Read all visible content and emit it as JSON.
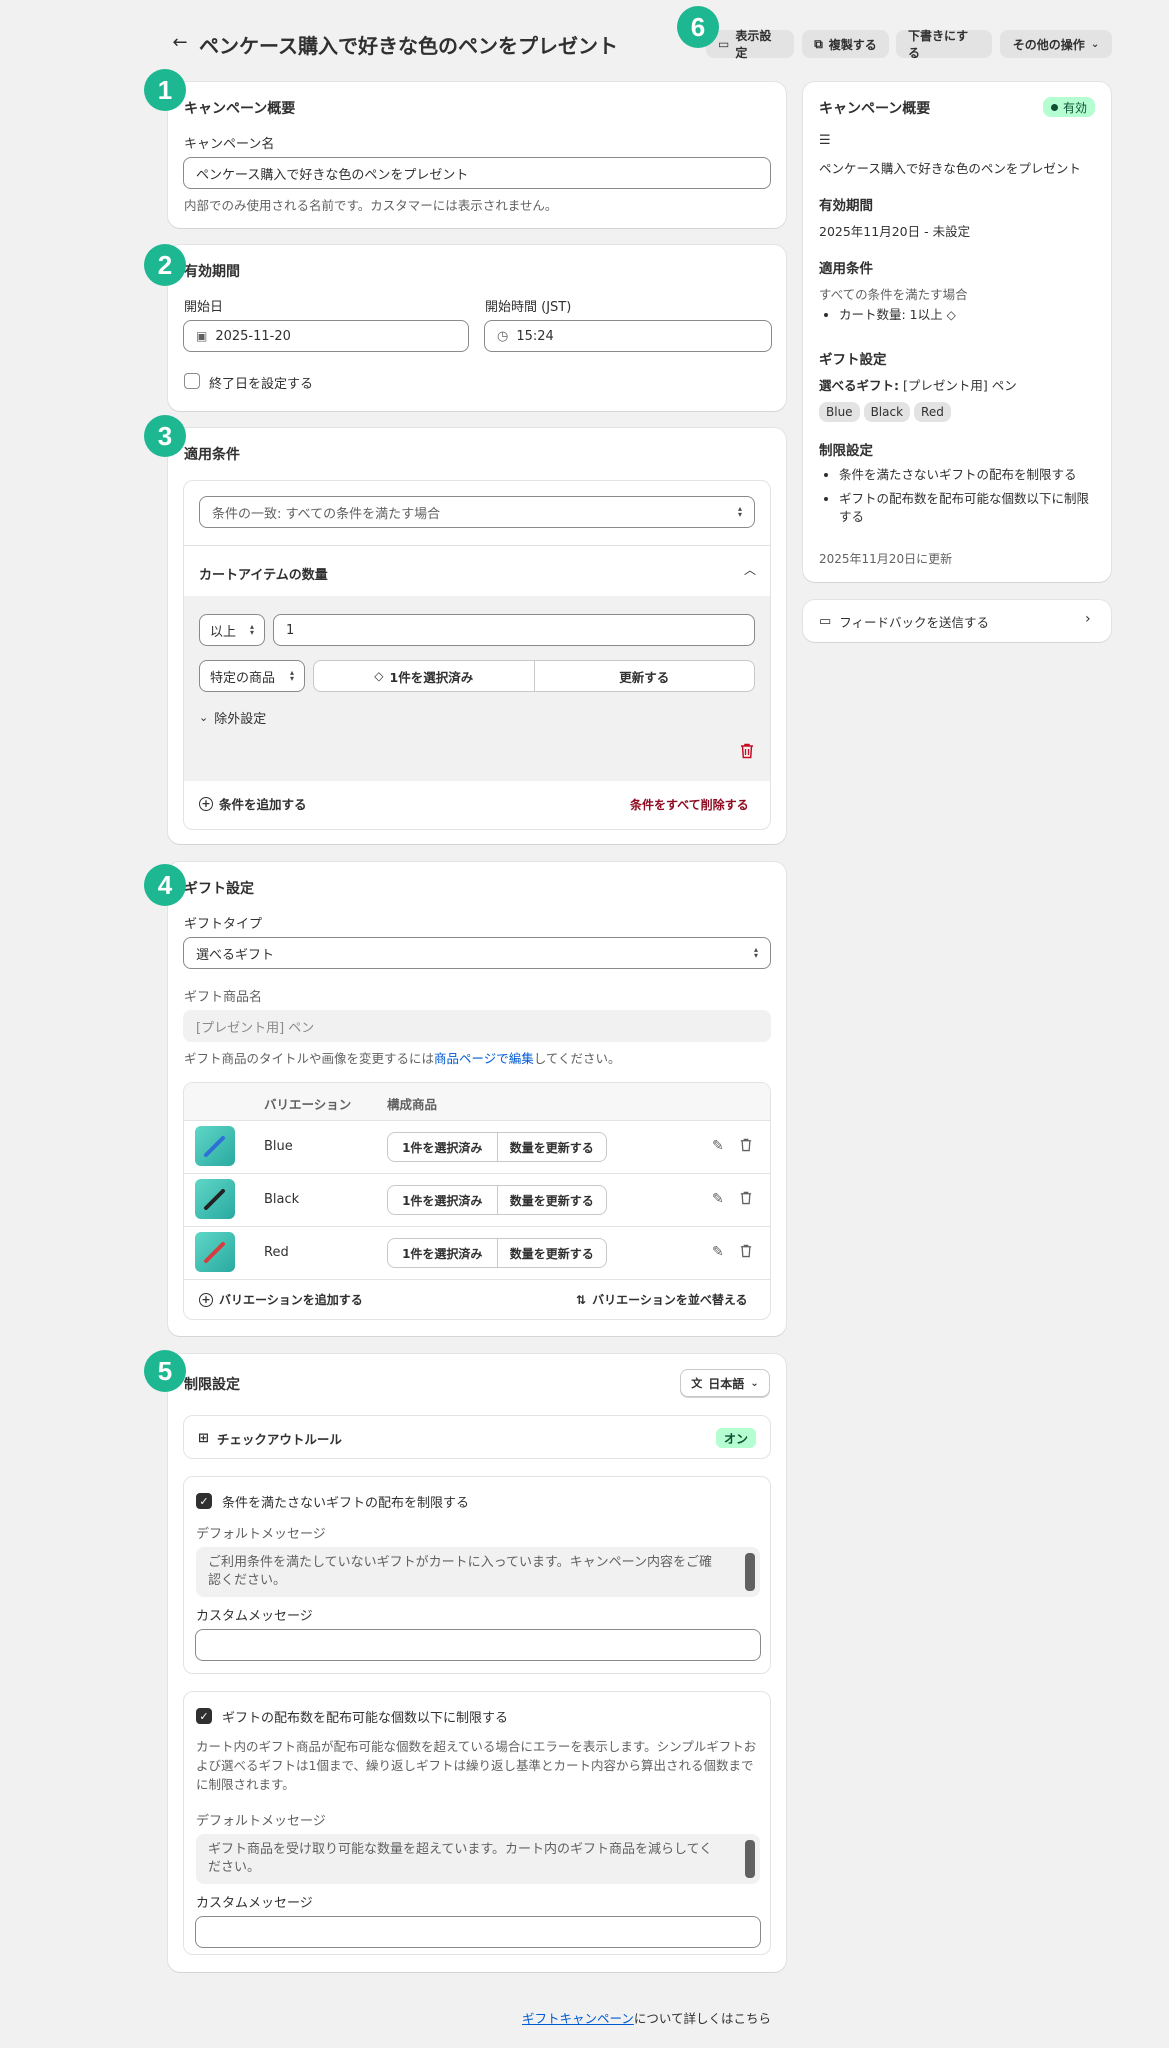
{
  "header": {
    "title": "ペンケース購入で好きな色のペンをプレゼント",
    "actions": {
      "display": "表示設定",
      "duplicate": "複製する",
      "draft": "下書きにする",
      "more": "その他の操作"
    }
  },
  "markers": [
    "1",
    "2",
    "3",
    "4",
    "5",
    "6"
  ],
  "overview": {
    "heading": "キャンペーン概要",
    "name_label": "キャンペーン名",
    "name_value": "ペンケース購入で好きな色のペンをプレゼント",
    "name_help": "内部でのみ使用される名前です。カスタマーには表示されません。"
  },
  "period": {
    "heading": "有効期間",
    "start_date_label": "開始日",
    "start_date_value": "2025-11-20",
    "start_time_label": "開始時間 (JST)",
    "start_time_value": "15:24",
    "end_date_checkbox": "終了日を設定する"
  },
  "conditions": {
    "heading": "適用条件",
    "match_select": "条件の一致: すべての条件を満たす場合",
    "cart_qty_heading": "カートアイテムの数量",
    "operator": "以上",
    "qty_value": "1",
    "product_scope": "特定の商品",
    "selected": "1件を選択済み",
    "update": "更新する",
    "exclusion": "除外設定",
    "add_condition": "条件を追加する",
    "delete_all": "条件をすべて削除する"
  },
  "gift": {
    "heading": "ギフト設定",
    "type_label": "ギフトタイプ",
    "type_value": "選べるギフト",
    "product_name_label": "ギフト商品名",
    "product_name_value": "[プレゼント用] ペン",
    "help_pre": "ギフト商品のタイトルや画像を変更するには",
    "help_link": "商品ページで編集",
    "help_post": "してください。",
    "col_variation": "バリエーション",
    "col_components": "構成商品",
    "rows": [
      {
        "name": "Blue",
        "selected": "1件を選択済み",
        "update": "数量を更新する",
        "color": "#2f6fd6"
      },
      {
        "name": "Black",
        "selected": "1件を選択済み",
        "update": "数量を更新する",
        "color": "#222222"
      },
      {
        "name": "Red",
        "selected": "1件を選択済み",
        "update": "数量を更新する",
        "color": "#d83b3b"
      }
    ],
    "add_variation": "バリエーションを追加する",
    "sort_variation": "バリエーションを並べ替える"
  },
  "limits": {
    "heading": "制限設定",
    "language": "日本語",
    "checkout_rule": "チェックアウトルール",
    "checkout_status": "オン",
    "rule1_label": "条件を満たさないギフトの配布を制限する",
    "default_msg_label": "デフォルトメッセージ",
    "rule1_default": "ご利用条件を満たしていないギフトがカートに入っています。キャンペーン内容をご確認ください。",
    "custom_msg_label": "カスタムメッセージ",
    "rule2_label": "ギフトの配布数を配布可能な個数以下に制限する",
    "rule2_desc": "カート内のギフト商品が配布可能な個数を超えている場合にエラーを表示します。シンプルギフトおよび選べるギフトは1個まで、繰り返しギフトは繰り返し基準とカート内容から算出される個数までに制限されます。",
    "rule2_default": "ギフト商品を受け取り可能な数量を超えています。カート内のギフト商品を減らしてください。"
  },
  "summary": {
    "heading": "キャンペーン概要",
    "status": "有効",
    "name": "ペンケース購入で好きな色のペンをプレゼント",
    "period_heading": "有効期間",
    "period_value": "2025年11月20日 - 未設定",
    "cond_heading": "適用条件",
    "cond_desc": "すべての条件を満たす場合",
    "cond_item": "カート数量: 1以上",
    "gift_heading": "ギフト設定",
    "gift_label": "選べるギフト:",
    "gift_value": "[プレゼント用] ペン",
    "pills": [
      "Blue",
      "Black",
      "Red"
    ],
    "limit_heading": "制限設定",
    "limit_items": [
      "条件を満たさないギフトの配布を制限する",
      "ギフトの配布数を配布可能な個数以下に制限する"
    ],
    "updated": "2025年11月20日に更新"
  },
  "feedback": "フィードバックを送信する",
  "footer": {
    "link": "ギフトキャンペーン",
    "text": "について詳しくはこちら"
  }
}
